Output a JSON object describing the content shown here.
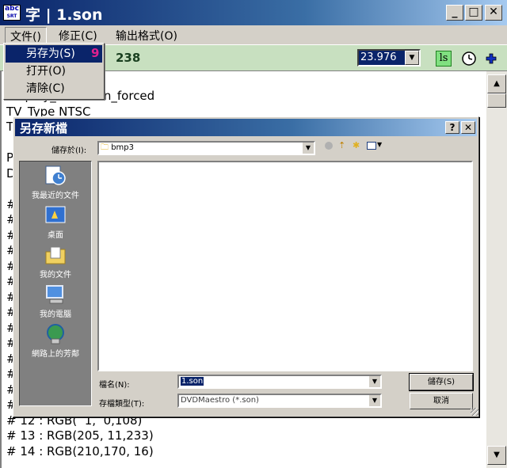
{
  "window": {
    "icon_text": "abc\nSRT SUP",
    "title": "字 | 1.son",
    "minimize_glyph": "_",
    "maximize_glyph": "□",
    "close_glyph": "✕"
  },
  "menubar": {
    "items": [
      {
        "label": "文件()"
      },
      {
        "label": "修正(C)"
      },
      {
        "label": "输出格式(O)"
      }
    ]
  },
  "file_menu": {
    "items": [
      {
        "label": "另存为(S)"
      },
      {
        "label": "打开(O)"
      },
      {
        "label": "清除(C)"
      }
    ],
    "badge": "9"
  },
  "toolbar": {
    "number": "238",
    "fps_value": "23.976",
    "ls_label": "ls",
    "accent": "#c8e0c0"
  },
  "editor": {
    "lines": [
      "Display_Start non_forced",
      "TV_Type NTSC",
      "T",
      "",
      "P",
      "D",
      "",
      "#",
      "#",
      "#",
      "#",
      "#",
      "#",
      "#",
      "#",
      "#",
      "#",
      "#",
      "#",
      "#",
      "#",
      "# 12 : RGB(  1,  0,108)",
      "# 13 : RGB(205, 11,233)",
      "# 14 : RGB(210,170, 16)"
    ]
  },
  "dialog": {
    "title": "另存新檔",
    "help_glyph": "?",
    "close_glyph": "✕",
    "save_in_label": "儲存於(I):",
    "save_in_value": "bmp3",
    "places": [
      {
        "label": "我最近的文件",
        "icon": "recent-documents-icon"
      },
      {
        "label": "桌面",
        "icon": "desktop-icon"
      },
      {
        "label": "我的文件",
        "icon": "my-documents-icon"
      },
      {
        "label": "我的電腦",
        "icon": "my-computer-icon"
      },
      {
        "label": "網路上的芳鄰",
        "icon": "network-places-icon"
      }
    ],
    "filename_label": "檔名(N):",
    "filename_value": "1.son",
    "filetype_label": "存檔類型(T):",
    "filetype_value": "DVDMaestro (*.son)",
    "save_button": "儲存(S)",
    "cancel_button": "取消"
  }
}
